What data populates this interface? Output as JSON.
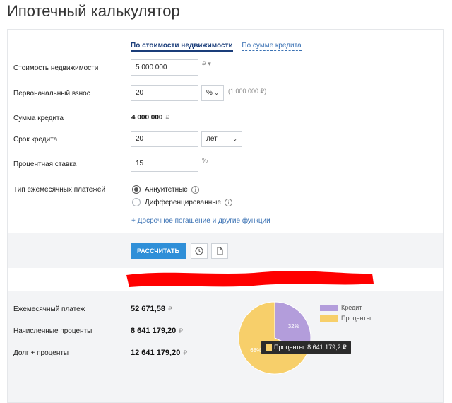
{
  "page": {
    "title": "Ипотечный калькулятор"
  },
  "tabs": [
    {
      "label": "По стоимости недвижимости",
      "active": true
    },
    {
      "label": "По сумме кредита",
      "active": false
    }
  ],
  "form": {
    "property_cost": {
      "label": "Стоимость недвижимости",
      "value": "5 000 000",
      "unit": "₽ ▾"
    },
    "down_payment": {
      "label": "Первоначальный взнос",
      "value": "20",
      "unit_select": "%",
      "hint": "(1 000 000 ₽)"
    },
    "loan_amount": {
      "label": "Сумма кредита",
      "value": "4 000 000",
      "unit": "₽"
    },
    "term": {
      "label": "Срок кредита",
      "value": "20",
      "unit_select": "лет"
    },
    "rate": {
      "label": "Процентная ставка",
      "value": "15",
      "unit": "%"
    },
    "payment_type": {
      "label": "Тип ежемесячных платежей",
      "options": [
        {
          "label": "Аннуитетные",
          "checked": true
        },
        {
          "label": "Дифференцированные",
          "checked": false
        }
      ]
    },
    "extra_link": "+ Досрочное погашение и другие функции"
  },
  "actions": {
    "calculate_label": "РАССЧИТАТЬ",
    "history_icon": "clock-icon",
    "export_icon": "document-icon"
  },
  "results": {
    "monthly_payment": {
      "label": "Ежемесячный платеж",
      "value": "52 671,58",
      "unit": "₽"
    },
    "interest": {
      "label": "Начисленные проценты",
      "value": "8 641 179,20",
      "unit": "₽"
    },
    "total": {
      "label": "Долг + проценты",
      "value": "12 641 179,20",
      "unit": "₽"
    }
  },
  "chart_data": {
    "type": "pie",
    "slices": [
      {
        "name": "Кредит",
        "percent": 32,
        "label": "32%",
        "color": "#b39ddb"
      },
      {
        "name": "Проценты",
        "percent": 68,
        "label": "68%",
        "color": "#f7cf6a"
      }
    ],
    "tooltip": "Проценты: 8 641 179,2 ₽",
    "legend": "right"
  },
  "colors": {
    "accent": "#2f8fd8",
    "tab_active": "#1a3d7a",
    "link": "#3b72b4",
    "redaction": "#ff0000"
  }
}
